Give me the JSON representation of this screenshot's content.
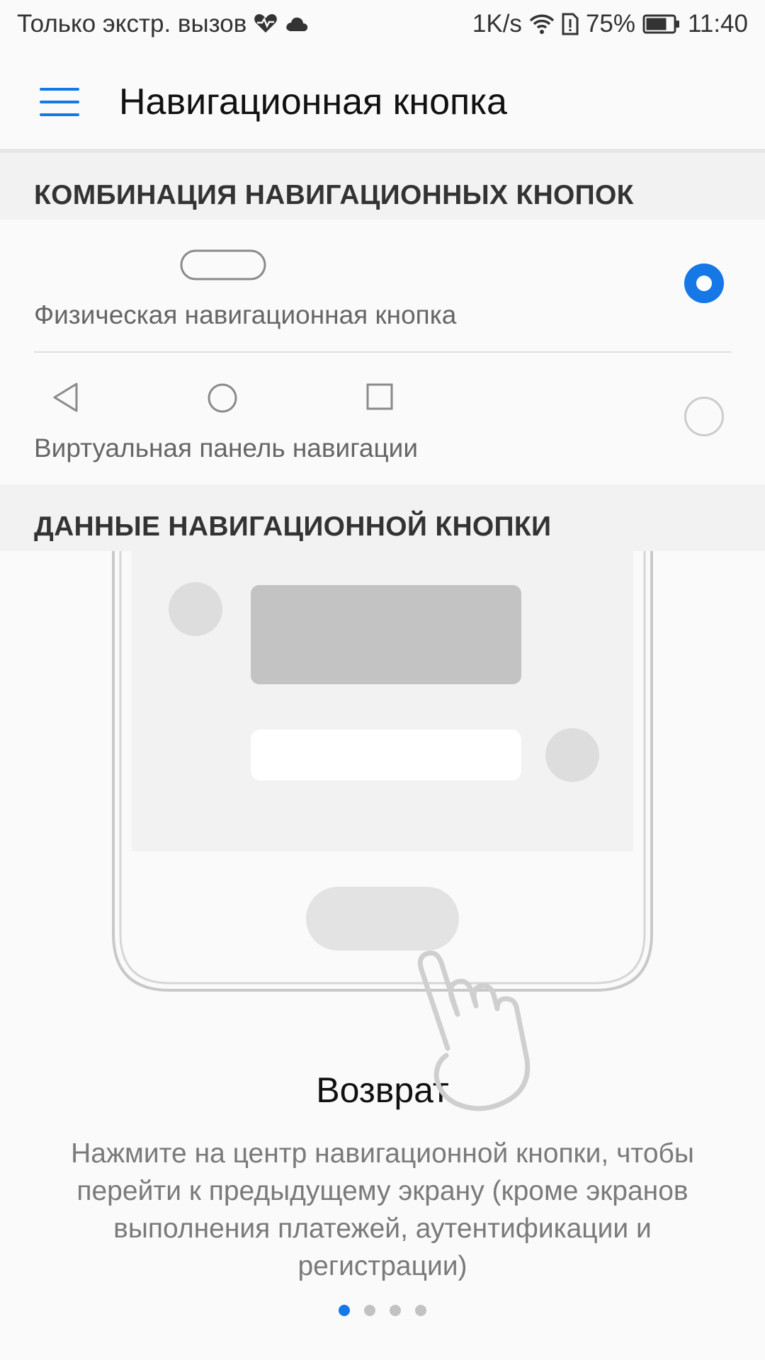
{
  "status_bar": {
    "carrier_text": "Только экстр. вызов",
    "net_speed": "1K/s",
    "battery_percent": "75%",
    "time": "11:40"
  },
  "appbar": {
    "title": "Навигационная кнопка",
    "menu_icon": "hamburger-menu-icon"
  },
  "sections": {
    "combo_header": "КОМБИНАЦИЯ НАВИГАЦИОННЫХ КНОПОК",
    "data_header": "ДАННЫЕ НАВИГАЦИОННОЙ КНОПКИ"
  },
  "options": [
    {
      "label": "Физическая навигационная кнопка",
      "selected": true
    },
    {
      "label": "Виртуальная панель навигации",
      "selected": false
    }
  ],
  "tutorial": {
    "title": "Возврат",
    "description": "Нажмите на центр навигационной кнопки, чтобы перейти к предыдущему экрану (кроме экранов выполнения платежей, аутентификации и регистрации)",
    "page_count": 4,
    "active_page": 1
  },
  "colors": {
    "accent": "#1677e6",
    "section_bg": "#f2f2f2",
    "background": "#fafafa"
  }
}
